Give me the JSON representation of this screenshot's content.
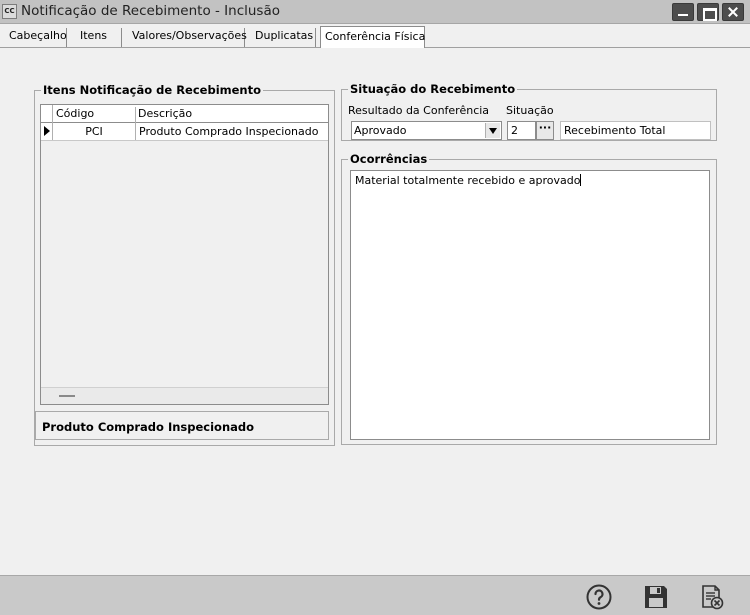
{
  "window": {
    "icon_text": "CC",
    "title": "Notificação de Recebimento - Inclusão"
  },
  "tabs": [
    {
      "label": "Cabeçalho",
      "active": false
    },
    {
      "label": "Itens",
      "active": false
    },
    {
      "label": "Valores/Observações",
      "active": false
    },
    {
      "label": "Duplicatas",
      "active": false
    },
    {
      "label": "Conferência Física",
      "active": true
    }
  ],
  "itens_group": {
    "title": "Itens Notificação de Recebimento",
    "columns": [
      "Código",
      "Descrição"
    ],
    "rows": [
      {
        "codigo": "PCI",
        "descricao": "Produto Comprado Inspecionado"
      }
    ],
    "selected_description": "Produto Comprado Inspecionado"
  },
  "situacao_group": {
    "title": "Situação do Recebimento",
    "resultado_label": "Resultado da Conferência",
    "resultado_value": "Aprovado",
    "situacao_label": "Situação",
    "situacao_code": "2",
    "lookup_label": "···",
    "situacao_desc": "Recebimento Total"
  },
  "ocorrencias_group": {
    "title": "Ocorrências",
    "text": "Material totalmente recebido e aprovado"
  },
  "toolbar": {
    "icons": [
      "help-icon",
      "save-icon",
      "cancel-icon"
    ]
  }
}
